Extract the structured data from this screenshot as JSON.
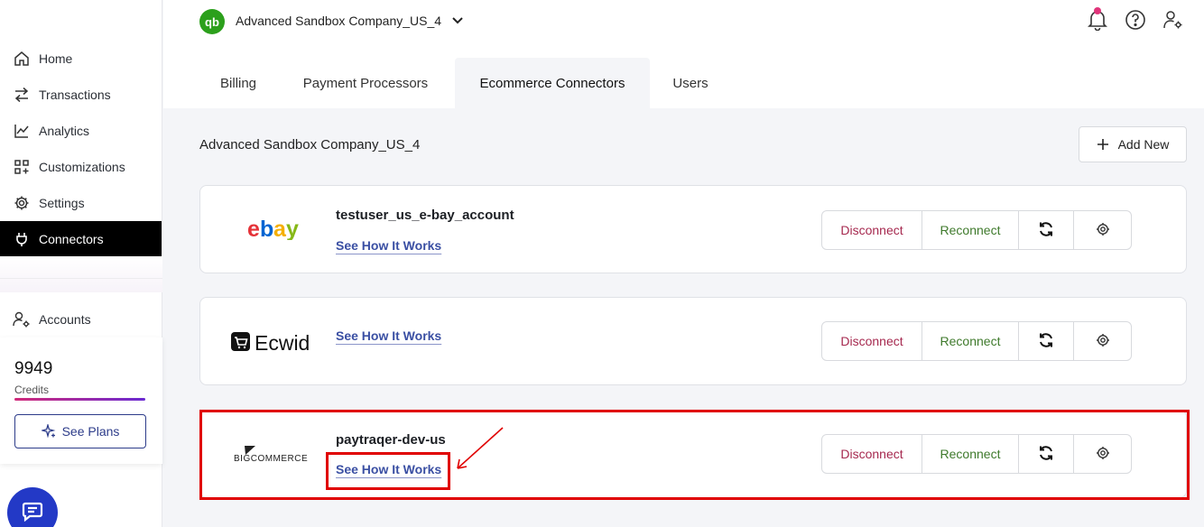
{
  "sidebar": {
    "items": [
      {
        "label": "Home",
        "icon": "home-icon"
      },
      {
        "label": "Transactions",
        "icon": "transfer-icon"
      },
      {
        "label": "Analytics",
        "icon": "chart-icon"
      },
      {
        "label": "Customizations",
        "icon": "grid-plus-icon"
      },
      {
        "label": "Settings",
        "icon": "gear-icon"
      },
      {
        "label": "Connectors",
        "icon": "plug-icon",
        "active": true
      }
    ],
    "accounts_label": "Accounts",
    "credits_value": "9949",
    "credits_label": "Credits",
    "see_plans_label": "See Plans"
  },
  "header": {
    "company_name": "Advanced Sandbox Company_US_4",
    "logo_text": "qb"
  },
  "tabs": [
    {
      "label": "Billing"
    },
    {
      "label": "Payment Processors"
    },
    {
      "label": "Ecommerce Connectors",
      "active": true
    },
    {
      "label": "Users"
    }
  ],
  "main": {
    "section_title": "Advanced Sandbox Company_US_4",
    "add_new_label": "Add New",
    "connectors": [
      {
        "logo": "ebay",
        "name": "testuser_us_e-bay_account",
        "link": "See How It Works"
      },
      {
        "logo": "Ecwid",
        "name": "",
        "link": "See How It Works"
      },
      {
        "logo": "BIGCOMMERCE",
        "name": "paytraqer-dev-us",
        "link": "See How It Works"
      }
    ],
    "actions": {
      "disconnect": "Disconnect",
      "reconnect": "Reconnect"
    }
  },
  "colors": {
    "brand_green": "#2ca01c",
    "active_nav": "#000000",
    "link_blue": "#3a4fa3",
    "disconnect": "#a6294f",
    "reconnect": "#3f7a2c",
    "annotation_red": "#e00000"
  }
}
